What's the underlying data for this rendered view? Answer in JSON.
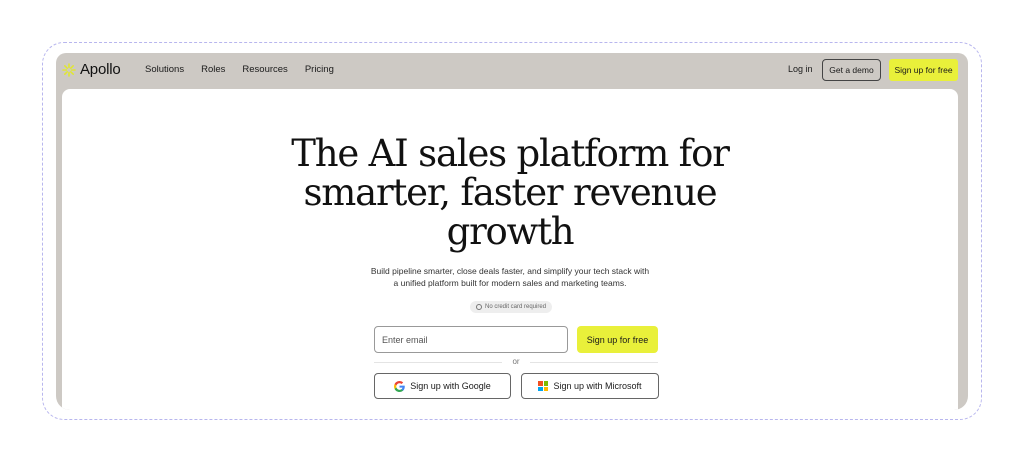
{
  "nav": {
    "brand": "Apollo",
    "links": [
      "Solutions",
      "Roles",
      "Resources",
      "Pricing"
    ],
    "login": "Log in",
    "demo": "Get a demo",
    "signup": "Sign up for free"
  },
  "hero": {
    "headline_lines": [
      "The AI sales platform for",
      "smarter, faster revenue",
      "growth"
    ],
    "subtext_lines": [
      "Build pipeline smarter, close deals faster, and simplify your tech stack with",
      "a unified platform built for modern sales and marketing teams."
    ],
    "badge": "No credit card required",
    "email_placeholder": "Enter email",
    "signup": "Sign up for free",
    "divider": "or",
    "google": "Sign up with Google",
    "microsoft": "Sign up with Microsoft"
  },
  "icons": {
    "logo": "apollo-sunburst-icon",
    "badge": "check-circle-icon",
    "google": "google-icon",
    "microsoft": "microsoft-icon"
  },
  "colors": {
    "accent": "#e9f03a",
    "frame": "#cdc9c4",
    "dashed_border": "#b8b6ee",
    "google_blue": "#4285f4",
    "ms_red": "#f25022",
    "ms_green": "#7fba00",
    "ms_blue": "#00a4ef",
    "ms_yellow": "#ffb900"
  }
}
